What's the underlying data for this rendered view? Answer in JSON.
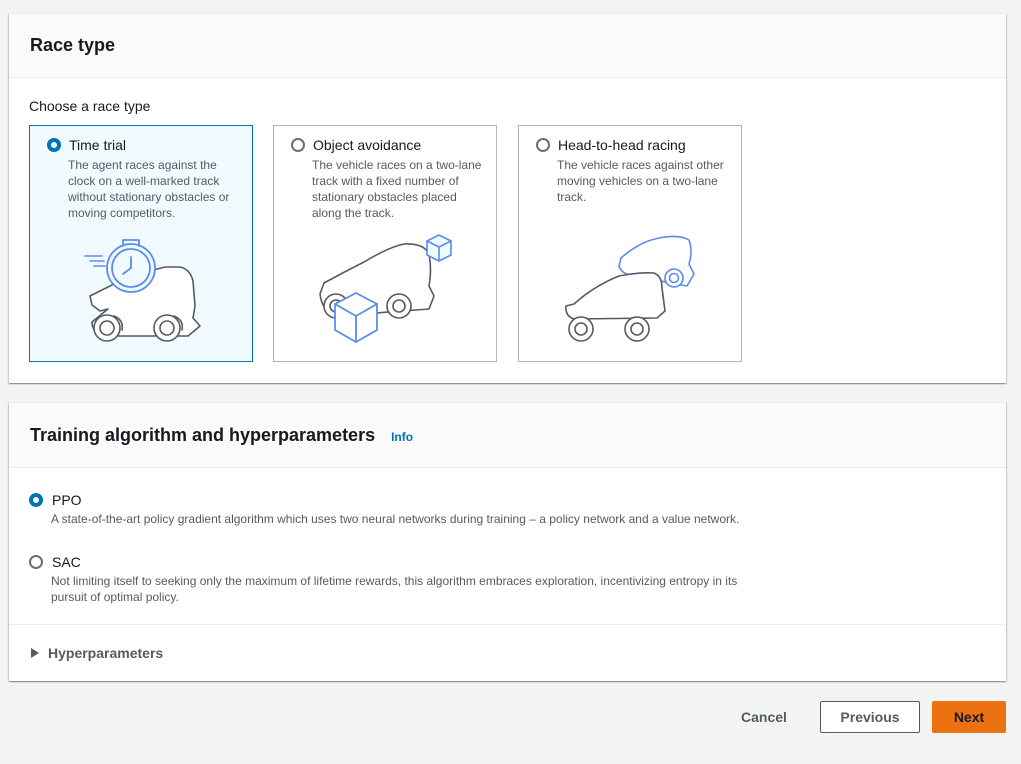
{
  "race_type": {
    "title": "Race type",
    "prompt": "Choose a race type",
    "options": [
      {
        "label": "Time trial",
        "description": "The agent races against the clock on a well-marked track without stationary obstacles or moving competitors.",
        "selected": true,
        "illustration": "car-with-clock-icon"
      },
      {
        "label": "Object avoidance",
        "description": "The vehicle races on a two-lane track with a fixed number of stationary obstacles placed along the track.",
        "selected": false,
        "illustration": "car-with-boxes-icon"
      },
      {
        "label": "Head-to-head racing",
        "description": "The vehicle races against other moving vehicles on a two-lane track.",
        "selected": false,
        "illustration": "two-cars-icon"
      }
    ]
  },
  "training": {
    "title": "Training algorithm and hyperparameters",
    "info_link": "Info",
    "algorithms": [
      {
        "label": "PPO",
        "description": "A state-of-the-art policy gradient algorithm which uses two neural networks during training – a policy network and a value network.",
        "selected": true
      },
      {
        "label": "SAC",
        "description": "Not limiting itself to seeking only the maximum of lifetime rewards, this algorithm embraces exploration, incentivizing entropy in its pursuit of optimal policy.",
        "selected": false
      }
    ],
    "hyperparameters_label": "Hyperparameters",
    "hyperparameters_expanded": false
  },
  "actions": {
    "cancel": "Cancel",
    "previous": "Previous",
    "next": "Next"
  },
  "colors": {
    "accent_blue": "#0073bb",
    "illustration_blue": "#5a8cf0",
    "primary_button": "#ec7211",
    "border": "#aab7b8",
    "page_background": "#f2f3f3"
  }
}
